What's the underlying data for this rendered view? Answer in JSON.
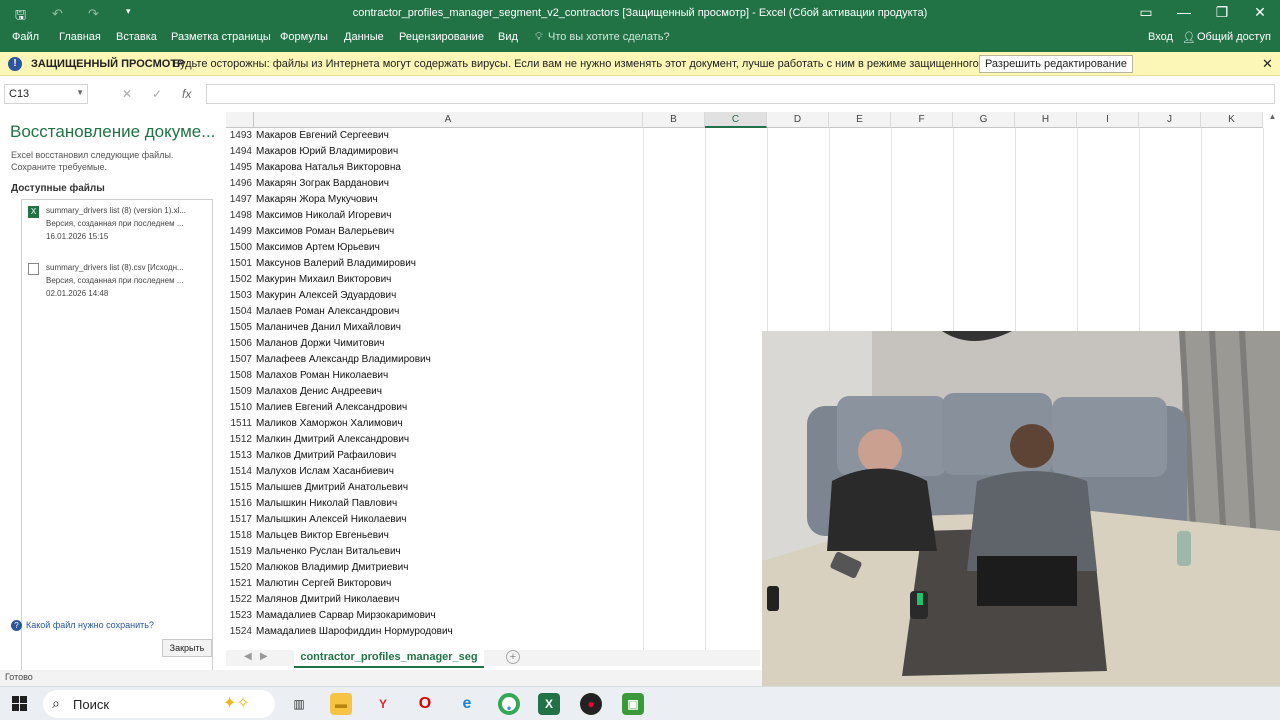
{
  "window": {
    "title": "contractor_profiles_manager_segment_v2_contractors  [Защищенный просмотр] - Excel (Сбой активации продукта)"
  },
  "menu": {
    "items": [
      "Файл",
      "Главная",
      "Вставка",
      "Разметка страницы",
      "Формулы",
      "Данные",
      "Рецензирование",
      "Вид"
    ],
    "tell_me": "Что вы хотите сделать?",
    "signin": "Вход",
    "share": "Общий доступ"
  },
  "protected": {
    "title": "ЗАЩИЩЕННЫЙ ПРОСМОТР",
    "message": "Будьте осторожны: файлы из Интернета могут содержать вирусы. Если вам не нужно изменять этот документ, лучше работать с ним в режиме защищенного просмотра.",
    "enable_button": "Разрешить редактирование"
  },
  "formula": {
    "namebox": "C13",
    "value": ""
  },
  "recovery": {
    "title": "Восстановление докуме...",
    "description": "Excel восстановил следующие файлы. Сохраните требуемые.",
    "available": "Доступные файлы",
    "files": [
      {
        "name": "summary_drivers list (8) (version 1).xl...",
        "desc": "Версия, созданная при последнем ...",
        "date": "16.01.2026 15:15",
        "icon": "excel-file-icon"
      },
      {
        "name": "summary_drivers list (8).csv  [Исходн...",
        "desc": "Версия, созданная при последнем ...",
        "date": "02.01.2026 14:48",
        "icon": "csv-file-icon"
      }
    ],
    "question": "Какой файл нужно сохранить?",
    "close": "Закрыть"
  },
  "sheet": {
    "columns": [
      "A",
      "B",
      "C",
      "D",
      "E",
      "F",
      "G",
      "H",
      "I",
      "J",
      "K"
    ],
    "selected_column": "C",
    "rows": [
      {
        "n": "1493",
        "a": "Макаров Евгений Сергеевич"
      },
      {
        "n": "1494",
        "a": "Макаров Юрий Владимирович"
      },
      {
        "n": "1495",
        "a": "Макарова Наталья Викторовна"
      },
      {
        "n": "1496",
        "a": "Макарян Зограк Варданович"
      },
      {
        "n": "1497",
        "a": "Макарян Жора Мукучович"
      },
      {
        "n": "1498",
        "a": "Максимов Николай Игоревич"
      },
      {
        "n": "1499",
        "a": "Максимов Роман Валерьевич"
      },
      {
        "n": "1500",
        "a": "Максимов Артем Юрьевич"
      },
      {
        "n": "1501",
        "a": "Максунов Валерий Владимирович"
      },
      {
        "n": "1502",
        "a": "Макурин Михаил Викторович"
      },
      {
        "n": "1503",
        "a": "Макурин Алексей Эдуардович"
      },
      {
        "n": "1504",
        "a": "Малаев Роман Александрович"
      },
      {
        "n": "1505",
        "a": "Маланичев Данил Михайлович"
      },
      {
        "n": "1506",
        "a": "Маланов Доржи Чимитович"
      },
      {
        "n": "1507",
        "a": "Малафеев Александр Владимирович"
      },
      {
        "n": "1508",
        "a": "Малахов Роман Николаевич"
      },
      {
        "n": "1509",
        "a": "Малахов Денис Андреевич"
      },
      {
        "n": "1510",
        "a": "Малиев Евгений Александрович"
      },
      {
        "n": "1511",
        "a": "Маликов Хаморжон Халимович"
      },
      {
        "n": "1512",
        "a": "Малкин Дмитрий Александрович"
      },
      {
        "n": "1513",
        "a": "Малков Дмитрий Рафаилович"
      },
      {
        "n": "1514",
        "a": "Малухов Ислам Хасанбиевич"
      },
      {
        "n": "1515",
        "a": "Малышев Дмитрий Анатольевич"
      },
      {
        "n": "1516",
        "a": "Малышкин Николай Павлович"
      },
      {
        "n": "1517",
        "a": "Малышкин Алексей Николаевич"
      },
      {
        "n": "1518",
        "a": "Мальцев Виктор Евгеньевич"
      },
      {
        "n": "1519",
        "a": "Мальченко Руслан Витальевич"
      },
      {
        "n": "1520",
        "a": "Малюков Владимир Дмитриевич"
      },
      {
        "n": "1521",
        "a": "Малютин Сергей Викторович"
      },
      {
        "n": "1522",
        "a": "Малянов Дмитрий Николаевич"
      },
      {
        "n": "1523",
        "a": "Мамадалиев Сарвар Мирзокаримович"
      },
      {
        "n": "1524",
        "a": "Мамадалиев Шарофиддин Нормуродович"
      }
    ],
    "tab": "contractor_profiles_manager_seg"
  },
  "status": {
    "text": "Готово"
  },
  "taskbar": {
    "search": "Поиск"
  }
}
